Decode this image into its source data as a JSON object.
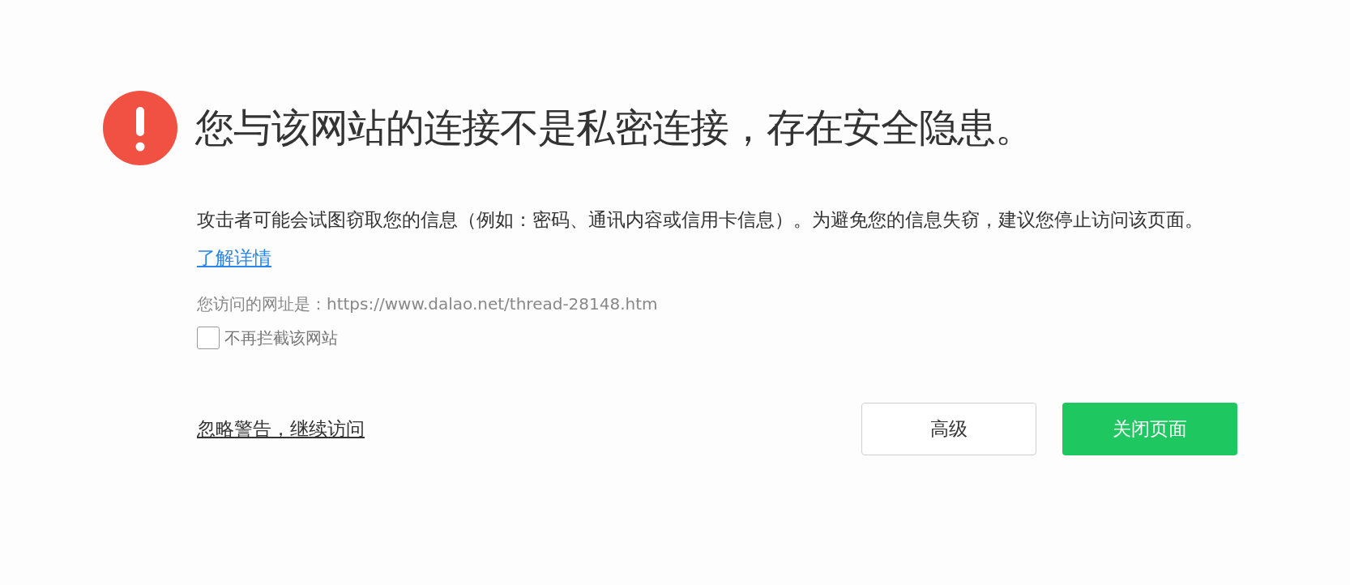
{
  "title": "您与该网站的连接不是私密连接，存在安全隐患。",
  "description": {
    "text": "攻击者可能会试图窃取您的信息（例如：密码、通讯内容或信用卡信息）。为避免您的信息失窃，建议您停止访问该页面。",
    "link": "了解详情"
  },
  "url_line": "您访问的网址是：https://www.dalao.net/thread-28148.htm",
  "checkbox": {
    "label": "不再拦截该网站",
    "checked": false
  },
  "ignore_link": "忽略警告，继续访问",
  "buttons": [
    {
      "label": "高级",
      "kind": "secondary"
    },
    {
      "label": "关闭页面",
      "kind": "primary"
    }
  ]
}
